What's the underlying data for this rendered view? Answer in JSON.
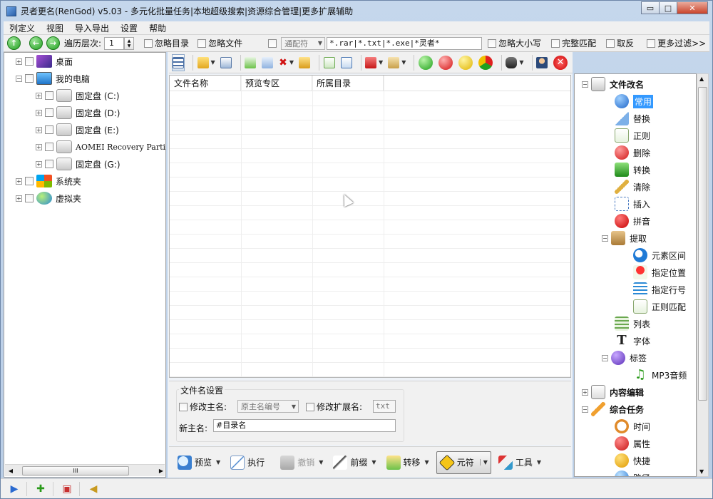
{
  "window": {
    "title": "灵者更名(RenGod) v5.03 - 多元化批量任务|本地超级搜索|资源综合管理|更多扩展辅助",
    "min_glyph": "▭",
    "max_glyph": "□",
    "close_glyph": "✕"
  },
  "menu": {
    "items": [
      "列定义",
      "视图",
      "导入导出",
      "设置",
      "帮助"
    ]
  },
  "toolbar": {
    "depth_label": "遍历层次:",
    "depth_value": "1",
    "ignore_dir": "忽略目录",
    "ignore_file": "忽略文件",
    "wildcard_combo": "通配符",
    "filter_text": "*.rar|*.txt|*.exe|*灵者*",
    "ignore_case": "忽略大小写",
    "full_match": "完整匹配",
    "invert": "取反",
    "more_filters": "更多过滤>>"
  },
  "tree": {
    "desktop": "桌面",
    "my_computer": "我的电脑",
    "drives": [
      "固定盘 (C:)",
      "固定盘 (D:)",
      "固定盘 (E:)",
      "AOMEI Recovery Parti",
      "固定盘 (G:)"
    ],
    "system_folder": "系统夹",
    "virtual_folder": "虚拟夹",
    "scroll_grip": "III"
  },
  "listview": {
    "columns": [
      "文件名称",
      "预览专区",
      "所属目录"
    ]
  },
  "settings": {
    "group_title": "文件名设置",
    "modify_main": "修改主名:",
    "main_combo": "原主名编号",
    "modify_ext": "修改扩展名:",
    "ext_value": "txt",
    "new_main_label": "新主名:",
    "new_main_value": "#目录名"
  },
  "bottom": {
    "preview": "预览",
    "execute": "执行",
    "undo": "撤销",
    "prefix": "前缀",
    "move": "转移",
    "element": "元符",
    "tools": "工具"
  },
  "right_tree": {
    "rename_title": "文件改名",
    "items": [
      "常用",
      "替换",
      "正则",
      "删除",
      "转换",
      "清除",
      "插入",
      "拼音",
      "提取"
    ],
    "extract_children": [
      "元素区间",
      "指定位置",
      "指定行号",
      "正则匹配"
    ],
    "after_extract": [
      "列表",
      "字体",
      "标签"
    ],
    "tag_children": [
      "MP3音频"
    ],
    "content_edit": "内容编辑",
    "combo_task": "综合任务",
    "task_children": [
      "时间",
      "属性",
      "快捷",
      "路径"
    ]
  },
  "colors": {
    "accent": "#3399ff",
    "titlebar": "#c5d7ec"
  }
}
